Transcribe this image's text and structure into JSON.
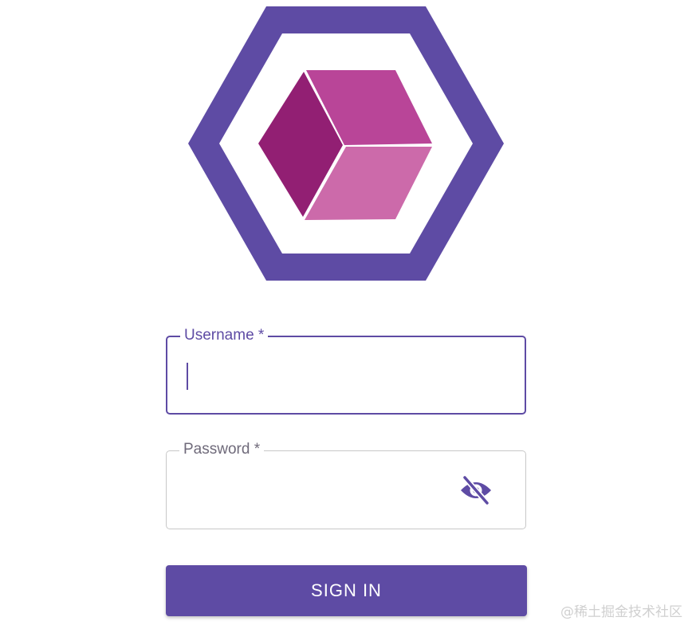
{
  "colors": {
    "primary": "#5e4ba4",
    "cube_top": "#b94598",
    "cube_left": "#921f73",
    "cube_right": "#cc6aaa",
    "field_border_idle": "#c8c8c8"
  },
  "logo": {
    "icon": "hexagon-cube-logo"
  },
  "username": {
    "label": "Username *",
    "value": ""
  },
  "password": {
    "label": "Password *",
    "value": "",
    "toggle_icon": "eye-off-icon"
  },
  "signin": {
    "label": "SIGN IN"
  },
  "watermark": {
    "text": "@稀土掘金技术社区"
  }
}
